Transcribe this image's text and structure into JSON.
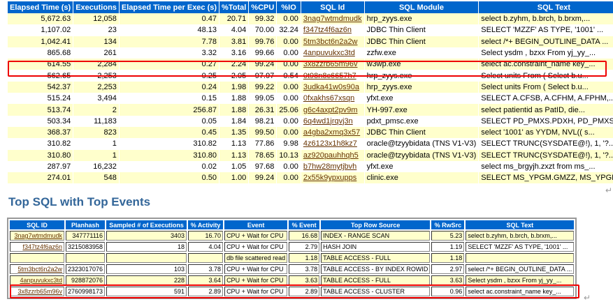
{
  "top_table": {
    "headers": [
      "Elapsed Time (s)",
      "Executions",
      "Elapsed Time per Exec (s)",
      "%Total",
      "%CPU",
      "%IO",
      "SQL Id",
      "SQL Module",
      "SQL Text"
    ],
    "rows": [
      [
        "5,672.63",
        "12,058",
        "0.47",
        "20.71",
        "99.32",
        "0.00",
        "3nag7wtmdmudk",
        "hrp_zyys.exe",
        "select b.zyhm, b.brch, b.brxm,..."
      ],
      [
        "1,107.02",
        "23",
        "48.13",
        "4.04",
        "70.00",
        "32.24",
        "f347tz4f6az6n",
        "JDBC Thin Client",
        "SELECT 'MZZF' AS TYPE, '1001' ..."
      ],
      [
        "1,042.41",
        "134",
        "7.78",
        "3.81",
        "99.76",
        "0.00",
        "5tm3bct6n2a2w",
        "JDBC Thin Client",
        "select /*+ BEGIN_OUTLINE_DATA ..."
      ],
      [
        "865.68",
        "261",
        "3.32",
        "3.16",
        "99.66",
        "0.00",
        "4anpuvukxc3td",
        "zzfw.exe",
        "Select ysdm , bzxx From yj_yy_..."
      ],
      [
        "614.55",
        "2,284",
        "0.27",
        "2.24",
        "99.24",
        "0.00",
        "3x8zzrb65m96v",
        "w3wp.exe",
        "select ac.constraint_name key_..."
      ],
      [
        "562.65",
        "2,253",
        "0.25",
        "2.05",
        "97.97",
        "0.54",
        "0t98n8c6657h7",
        "hrp_zyys.exe",
        "Select units From ( Select b.u..."
      ],
      [
        "542.37",
        "2,253",
        "0.24",
        "1.98",
        "99.22",
        "0.00",
        "3udka41w0s90a",
        "hrp_zyys.exe",
        "Select units From ( Select b.u..."
      ],
      [
        "515.24",
        "3,494",
        "0.15",
        "1.88",
        "99.05",
        "0.00",
        "0fxakhs67xsqn",
        "yfxt.exe",
        "SELECT A.CFSB, A.CFHM, A.FPHM,..."
      ],
      [
        "513.74",
        "2",
        "256.87",
        "1.88",
        "26.31",
        "25.06",
        "g6c4axpt2pv9m",
        "YH-997.exe",
        "select patientid as PatID, die..."
      ],
      [
        "503.34",
        "11,183",
        "0.05",
        "1.84",
        "98.21",
        "0.00",
        "6q4wd1jrqvj3n",
        "pdxt_pmsc.exe",
        "SELECT PD_PMXS.PDXH, PD_PMXS...."
      ],
      [
        "368.37",
        "823",
        "0.45",
        "1.35",
        "99.50",
        "0.00",
        "a4gba2xmq3x57",
        "JDBC Thin Client",
        "select '1001' as YYDM, NVL(( s..."
      ],
      [
        "310.82",
        "1",
        "310.82",
        "1.13",
        "77.86",
        "9.98",
        "4z6123x1h8kz7",
        "oracle@tzyybidata (TNS V1-V3)",
        "SELECT TRUNC(SYSDATE@!), 1, '?..."
      ],
      [
        "310.80",
        "1",
        "310.80",
        "1.13",
        "78.65",
        "10.13",
        "az920pauhhqh5",
        "oracle@tzyybidata (TNS V1-V3)",
        "SELECT TRUNC(SYSDATE@!), 1, '?..."
      ],
      [
        "287.97",
        "16,232",
        "0.02",
        "1.05",
        "97.68",
        "0.00",
        "b7hw28mytjbvh",
        "yfxt.exe",
        "select ms_brgyjh.zxzt from ms_..."
      ],
      [
        "274.01",
        "548",
        "0.50",
        "1.00",
        "99.24",
        "0.00",
        "2x55k9ypxupps",
        "clinic.exe",
        "SELECT MS_YPGM.GMZZ, MS_YPGM...."
      ]
    ]
  },
  "section_title": "Top SQL with Top Events",
  "events_table": {
    "headers": [
      "SQL ID",
      "Planhash",
      "Sampled # of Executions",
      "% Activity",
      "Event",
      "% Event",
      "Top Row Source",
      "% RwSrc",
      "SQL Text"
    ],
    "rows": [
      [
        "3nag7wtmdmudk",
        "347771116",
        "3403",
        "16.70",
        "CPU + Wait for CPU",
        "16.68",
        "INDEX - RANGE SCAN",
        "5.23",
        "select b.zyhm, b.brch, b.brxm,..."
      ],
      [
        "f347tz4f6az6n",
        "3215083958",
        "18",
        "4.04",
        "CPU + Wait for CPU",
        "2.79",
        "HASH JOIN",
        "1.19",
        "SELECT 'MZZF' AS TYPE, '1001' ..."
      ],
      [
        "",
        "",
        "",
        "",
        "db file scattered read",
        "1.18",
        "TABLE ACCESS - FULL",
        "1.18",
        ""
      ],
      [
        "5tm3bct6n2a2w",
        "2323017076",
        "103",
        "3.78",
        "CPU + Wait for CPU",
        "3.78",
        "TABLE ACCESS - BY INDEX ROWID",
        "2.97",
        "select /*+ BEGIN_OUTLINE_DATA ..."
      ],
      [
        "4anpuvukxc3td",
        "928872076",
        "228",
        "3.64",
        "CPU + Wait for CPU",
        "3.63",
        "TABLE ACCESS - FULL",
        "3.63",
        "Select ysdm , bzxx From yj_yy_..."
      ],
      [
        "3x8zzrb65m96v",
        "2760998173",
        "591",
        "2.89",
        "CPU + Wait for CPU",
        "2.89",
        "TABLE ACCESS - CLUSTER",
        "0.96",
        "select ac.constraint_name key_..."
      ]
    ]
  },
  "highlight_color": "#ee0000",
  "header_color": "#0066cc"
}
